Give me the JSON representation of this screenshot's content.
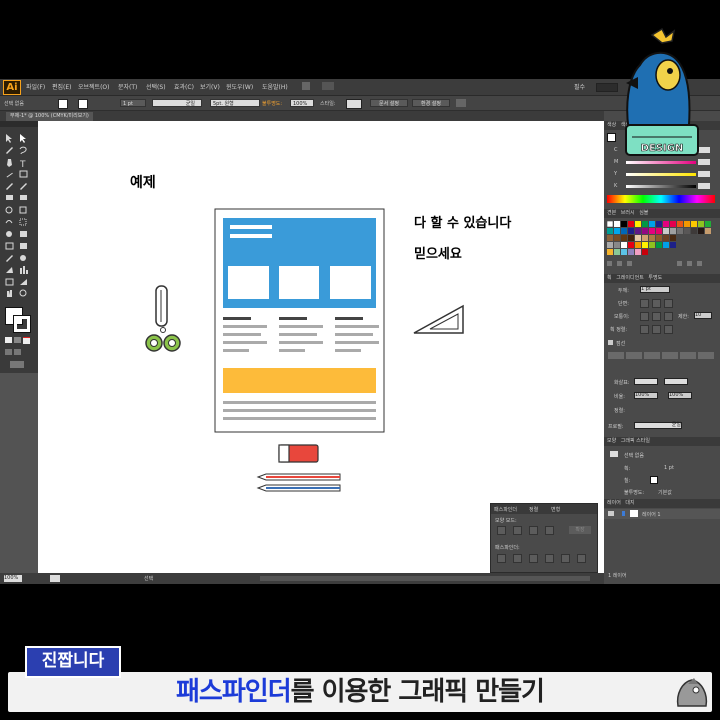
{
  "app": {
    "logo": "Ai",
    "menus": [
      "파일(F)",
      "편집(E)",
      "오브젝트(O)",
      "문자(T)",
      "선택(S)",
      "효과(C)",
      "보기(V)",
      "윈도우(W)",
      "도움말(H)"
    ],
    "workspace_label": "필수",
    "search_placeholder": ""
  },
  "control_bar": {
    "selection_label": "선택 없음",
    "stroke_weight": "1 pt",
    "stroke_profile": "균일",
    "brush": "5pt. 원형",
    "opacity_label": "불투명도:",
    "opacity_value": "100%",
    "style_label": "스타일:",
    "doc_setup_button": "문서 설정",
    "prefs_button": "환경 설정"
  },
  "document": {
    "tab_title": "무제-1* @ 100% (CMYK/미리보기)",
    "zoom": "100%",
    "status_text": "선택"
  },
  "canvas": {
    "example_label": "예제",
    "claim_line1": "다 할 수 있습니다",
    "claim_line2": "믿으세요"
  },
  "right_panel": {
    "color_tab": "색상",
    "color_guide_tab": "색상 안내",
    "channels": [
      "C",
      "M",
      "Y",
      "K"
    ],
    "swatches_tabs": [
      "견본",
      "브러시",
      "심볼"
    ],
    "stroke_tabs": [
      "획",
      "그레이디언트",
      "투명도"
    ],
    "stroke_weight_label": "두께:",
    "stroke_weight_value": "1 pt",
    "cap_label": "단면:",
    "corner_label": "모퉁이:",
    "limit_label": "제한:",
    "limit_value": "10",
    "align_label": "획 정렬:",
    "dashed_label": "점선",
    "arrow_label": "화살표:",
    "scale_label": "비율:",
    "scale_value_1": "100%",
    "scale_value_2": "100%",
    "align_row_label": "정렬:",
    "profile_label": "프로필:",
    "profile_value": "균일",
    "appearance_tabs": [
      "모양",
      "그래픽 스타일"
    ],
    "appearance_title": "선택 없음",
    "appearance_stroke": "획:",
    "appearance_stroke_value": "1 pt",
    "appearance_fill": "칠:",
    "appearance_opacity": "불투명도:",
    "appearance_opacity_value": "기본값",
    "layers_tabs": [
      "레이어",
      "대지"
    ],
    "layer_name": "레이어 1",
    "layers_count": "1 레이어"
  },
  "pathfinder": {
    "tabs": [
      "패스파인더",
      "정렬",
      "변형"
    ],
    "shape_modes_label": "모양 모드:",
    "expand_button": "확장",
    "pathfinders_label": "패스파인더:"
  },
  "overlay": {
    "mascot_label": "DESIGN",
    "badge": "진짭니다",
    "caption_highlight": "패스파인더",
    "caption_rest": "를 이용한 그래픽 만들기"
  },
  "colors": {
    "accent_blue": "#3a9bd9",
    "accent_yellow": "#fdbb3a",
    "eraser_red": "#e8473c",
    "scissors_green": "#8bc34a",
    "caption_blue": "#1c3bd8"
  }
}
